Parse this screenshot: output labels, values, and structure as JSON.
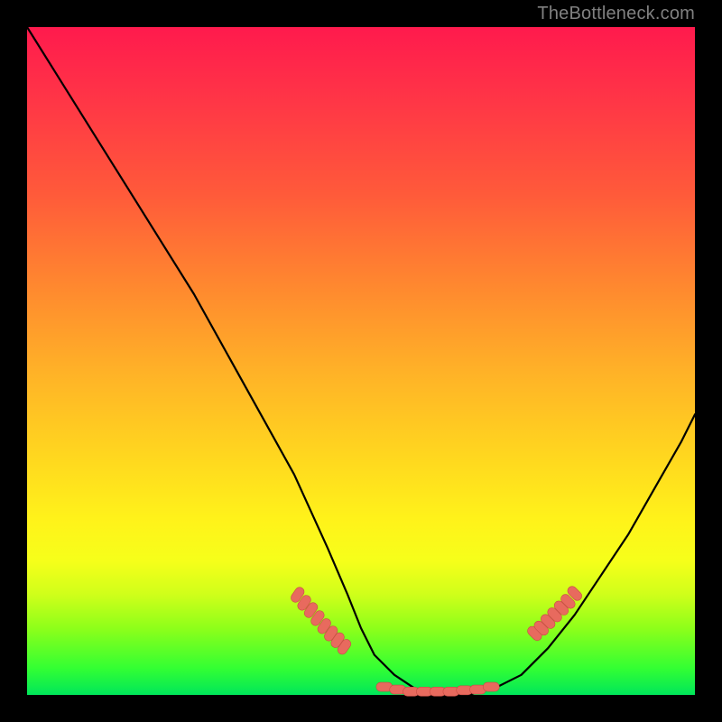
{
  "watermark": "TheBottleneck.com",
  "colors": {
    "background": "#000000",
    "gradient_top": "#ff1a4d",
    "gradient_mid": "#ffd61f",
    "gradient_bottom": "#00e65a",
    "curve": "#000000",
    "marker_fill": "#e86a5e",
    "marker_stroke": "#c84d44"
  },
  "chart_data": {
    "type": "line",
    "title": "",
    "xlabel": "",
    "ylabel": "",
    "xlim": [
      0,
      100
    ],
    "ylim": [
      0,
      100
    ],
    "grid": false,
    "legend": false,
    "series": [
      {
        "name": "bottleneck-curve",
        "x": [
          0,
          5,
          10,
          15,
          20,
          25,
          30,
          35,
          40,
          45,
          48,
          50,
          52,
          55,
          58,
          62,
          66,
          70,
          74,
          78,
          82,
          86,
          90,
          94,
          98,
          100
        ],
        "y": [
          100,
          92,
          84,
          76,
          68,
          60,
          51,
          42,
          33,
          22,
          15,
          10,
          6,
          3,
          1,
          0,
          0,
          1,
          3,
          7,
          12,
          18,
          24,
          31,
          38,
          42
        ]
      }
    ],
    "markers": [
      {
        "name": "left-cluster",
        "points": [
          {
            "x": 40.5,
            "y": 15.0
          },
          {
            "x": 41.5,
            "y": 13.8
          },
          {
            "x": 42.5,
            "y": 12.7
          },
          {
            "x": 43.5,
            "y": 11.5
          },
          {
            "x": 44.5,
            "y": 10.3
          },
          {
            "x": 45.5,
            "y": 9.2
          },
          {
            "x": 46.5,
            "y": 8.2
          },
          {
            "x": 47.5,
            "y": 7.2
          }
        ],
        "shape": "capsule",
        "angle_deg": -55
      },
      {
        "name": "bottom-cluster",
        "points": [
          {
            "x": 53.5,
            "y": 1.2
          },
          {
            "x": 55.5,
            "y": 0.8
          },
          {
            "x": 57.5,
            "y": 0.5
          },
          {
            "x": 59.5,
            "y": 0.5
          },
          {
            "x": 61.5,
            "y": 0.5
          },
          {
            "x": 63.5,
            "y": 0.5
          },
          {
            "x": 65.5,
            "y": 0.7
          },
          {
            "x": 67.5,
            "y": 0.8
          },
          {
            "x": 69.5,
            "y": 1.2
          }
        ],
        "shape": "capsule",
        "angle_deg": 0
      },
      {
        "name": "right-cluster",
        "points": [
          {
            "x": 76.0,
            "y": 9.2
          },
          {
            "x": 77.0,
            "y": 10.0
          },
          {
            "x": 78.0,
            "y": 11.0
          },
          {
            "x": 79.0,
            "y": 12.0
          },
          {
            "x": 80.0,
            "y": 13.0
          },
          {
            "x": 81.0,
            "y": 14.0
          },
          {
            "x": 82.0,
            "y": 15.2
          }
        ],
        "shape": "capsule",
        "angle_deg": 45
      }
    ]
  }
}
